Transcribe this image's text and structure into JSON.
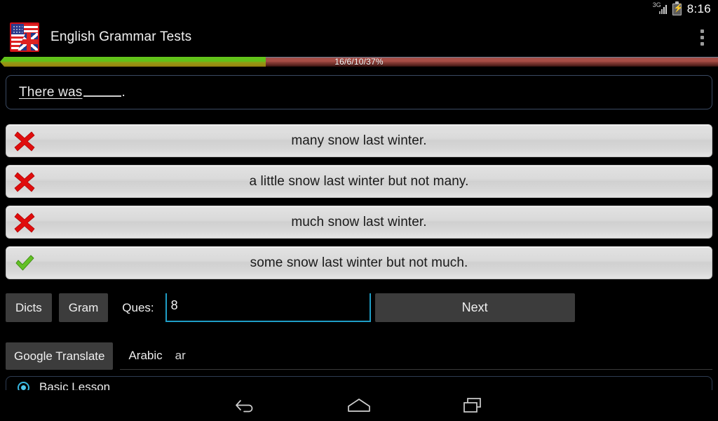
{
  "status_bar": {
    "network_type": "3G",
    "signal_icon": "signal-bars-icon",
    "battery_icon": "battery-charging-icon",
    "time": "8:16"
  },
  "app_bar": {
    "icon": "us-uk-flag-icon",
    "title": "English Grammar Tests",
    "overflow_icon": "overflow-menu-icon"
  },
  "progress": {
    "text": "16/6/10/37%",
    "percent": 37,
    "correct": 16,
    "wrong": 6,
    "remaining": 10,
    "fill_color": "#64c41b",
    "track_color": "#a94e46"
  },
  "question": {
    "prefix": "There was",
    "blank": "",
    "suffix": ".",
    "full_text": "There was _____."
  },
  "answers": [
    {
      "label": "many snow last winter.",
      "mark": "wrong",
      "mark_icon": "red-x-icon"
    },
    {
      "label": "a little snow last winter but not many.",
      "mark": "wrong",
      "mark_icon": "red-x-icon"
    },
    {
      "label": "much snow last winter.",
      "mark": "wrong",
      "mark_icon": "red-x-icon"
    },
    {
      "label": "some snow last winter but not much.",
      "mark": "correct",
      "mark_icon": "green-check-icon"
    }
  ],
  "controls": {
    "dicts_label": "Dicts",
    "gram_label": "Gram",
    "ques_label": "Ques:",
    "ques_value": "8",
    "ques_placeholder": "",
    "next_label": "Next"
  },
  "translate": {
    "button_label": "Google Translate",
    "language": "Arabic",
    "language_code": "ar"
  },
  "lesson": {
    "label": "Basic Lesson",
    "selected": true
  },
  "nav_bar": {
    "back_icon": "back-arrow-icon",
    "home_icon": "home-icon",
    "recents_icon": "recent-apps-icon"
  },
  "colors": {
    "accent_blue": "#1f9ec6",
    "wrong_red": "#e11f1f",
    "correct_green": "#6fbf2f",
    "background": "#000000",
    "button_gray": "#3c3c3c",
    "answer_row": "#d8d8d8"
  }
}
